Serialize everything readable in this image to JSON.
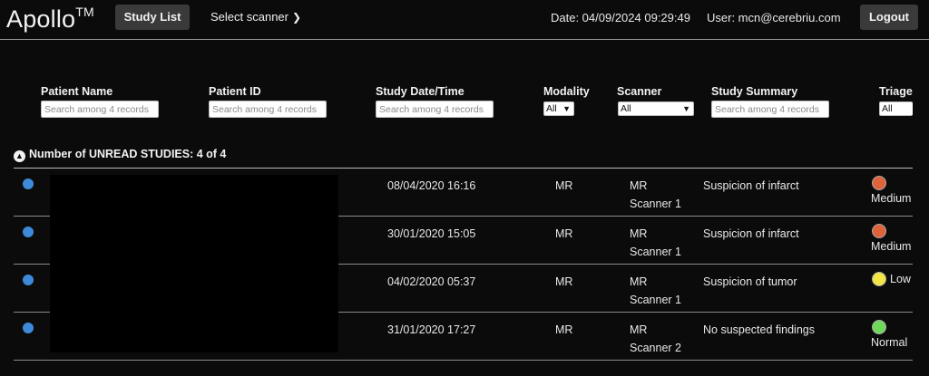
{
  "header": {
    "brand": "Apollo",
    "brand_mark": "TM",
    "study_list_label": "Study List",
    "select_scanner_label": "Select scanner",
    "date_text": "Date: 04/09/2024 09:29:49",
    "user_text": "User: mcn@cerebriu.com",
    "logout_label": "Logout"
  },
  "columns": {
    "patient_name": "Patient Name",
    "patient_id": "Patient ID",
    "study_date": "Study Date/Time",
    "modality": "Modality",
    "scanner": "Scanner",
    "study_summary": "Study Summary",
    "triage": "Triage"
  },
  "filters": {
    "placeholder": "Search among 4 records",
    "modality_selected": "All",
    "scanner_selected": "All",
    "triage_selected": "All"
  },
  "group": {
    "label": "Number of UNREAD STUDIES: 4 of 4"
  },
  "rows": [
    {
      "date": "08/04/2020 16:16",
      "modality": "MR",
      "scanner_line1": "MR",
      "scanner_line2": "Scanner 1",
      "summary": "Suspicion of infarct",
      "triage": "Medium",
      "triage_color": "#e0623a"
    },
    {
      "date": "30/01/2020 15:05",
      "modality": "MR",
      "scanner_line1": "MR",
      "scanner_line2": "Scanner 1",
      "summary": "Suspicion of infarct",
      "triage": "Medium",
      "triage_color": "#e0623a"
    },
    {
      "date": "04/02/2020 05:37",
      "modality": "MR",
      "scanner_line1": "MR",
      "scanner_line2": "Scanner 1",
      "summary": "Suspicion of tumor",
      "triage": "Low",
      "triage_color": "#f2e544"
    },
    {
      "date": "31/01/2020 17:27",
      "modality": "MR",
      "scanner_line1": "MR",
      "scanner_line2": "Scanner 2",
      "summary": "No suspected findings",
      "triage": "Normal",
      "triage_color": "#6fd85a"
    }
  ],
  "colors": {
    "background": "#0b0b0b",
    "button": "#3a3a3a",
    "unread_dot": "#3d8bd8"
  }
}
